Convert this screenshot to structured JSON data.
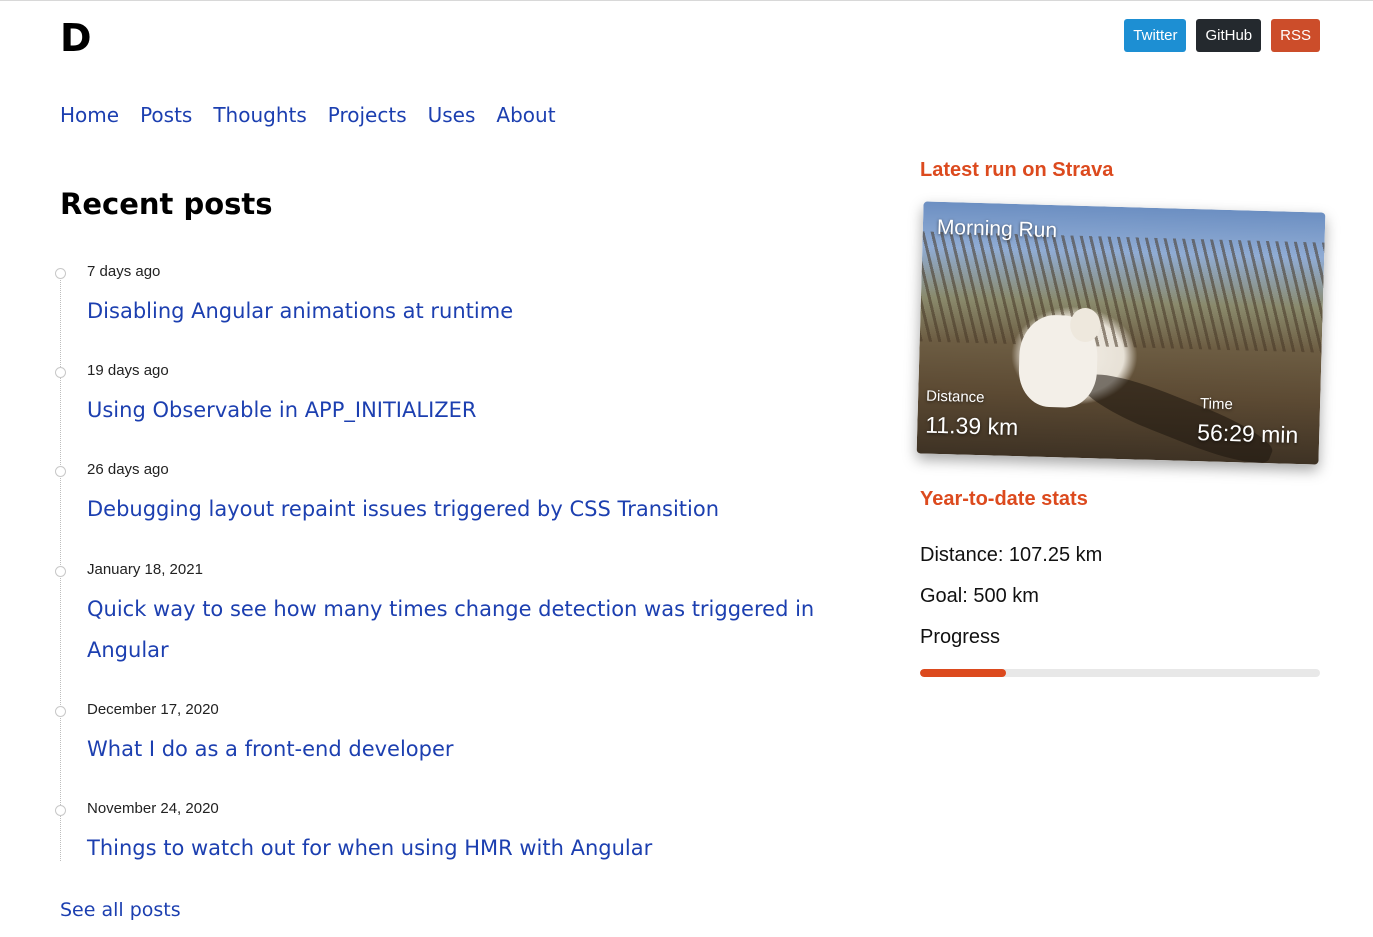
{
  "site": {
    "logo": "D"
  },
  "social": [
    {
      "label": "Twitter",
      "color": "#1d8fd3"
    },
    {
      "label": "GitHub",
      "color": "#24292e"
    },
    {
      "label": "RSS",
      "color": "#cc4d2a"
    }
  ],
  "nav": [
    "Home",
    "Posts",
    "Thoughts",
    "Projects",
    "Uses",
    "About"
  ],
  "recent": {
    "heading": "Recent posts",
    "posts": [
      {
        "date": "7 days ago",
        "title": "Disabling Angular animations at runtime"
      },
      {
        "date": "19 days ago",
        "title": "Using Observable in APP_INITIALIZER"
      },
      {
        "date": "26 days ago",
        "title": "Debugging layout repaint issues triggered by CSS Transition"
      },
      {
        "date": "January 18, 2021",
        "title": "Quick way to see how many times change detection was triggered in Angular"
      },
      {
        "date": "December 17, 2020",
        "title": "What I do as a front-end developer"
      },
      {
        "date": "November 24, 2020",
        "title": "Things to watch out for when using HMR with Angular"
      }
    ],
    "see_all": "See all posts"
  },
  "strava": {
    "heading": "Latest run on Strava",
    "run_name": "Morning Run",
    "distance_label": "Distance",
    "distance_value": "11.39 km",
    "time_label": "Time",
    "time_value": "56:29 min"
  },
  "ytd": {
    "heading": "Year-to-date stats",
    "distance": "Distance: 107.25 km",
    "goal": "Goal: 500 km",
    "progress_label": "Progress",
    "progress_fraction": 0.2145,
    "accent_color": "#dc4a1e"
  }
}
